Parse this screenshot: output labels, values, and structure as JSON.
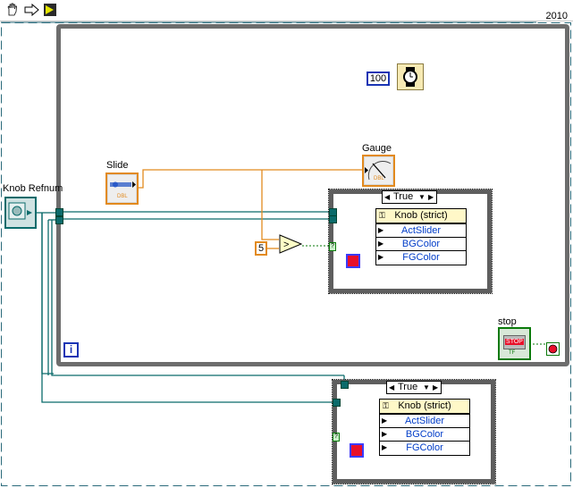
{
  "toolbar": {
    "hand_icon": "run-continuously-hand-icon",
    "arrow_icon": "run-arrow-icon",
    "highlight_icon": "highlight-execution-icon"
  },
  "version_label": "2010",
  "knob_refnum": {
    "label": "Knob Refnum"
  },
  "slide": {
    "label": "Slide",
    "type": "DBL",
    "scale": [
      "0",
      "5",
      "10"
    ]
  },
  "gauge": {
    "label": "Gauge",
    "type": "DBL"
  },
  "wait_constant": "100",
  "compare_constant": "5",
  "stop": {
    "label": "stop",
    "button_text": "STOP",
    "tf": "TF"
  },
  "loop_iteration": "i",
  "case_top": {
    "selector": "True",
    "property_node": {
      "header": "Knob (strict)",
      "rows": [
        "ActSlider",
        "BGColor",
        "FGColor"
      ]
    }
  },
  "case_bottom": {
    "selector": "True",
    "property_node": {
      "header": "Knob (strict)",
      "rows": [
        "ActSlider",
        "BGColor",
        "FGColor"
      ]
    }
  },
  "colors": {
    "wire_refnum": "#0b6b6b",
    "wire_dbl": "#e28a1e",
    "wire_bool": "#0a7a0a",
    "loop_border": "#6d6d6d",
    "blue_const": "#1a34b4"
  }
}
